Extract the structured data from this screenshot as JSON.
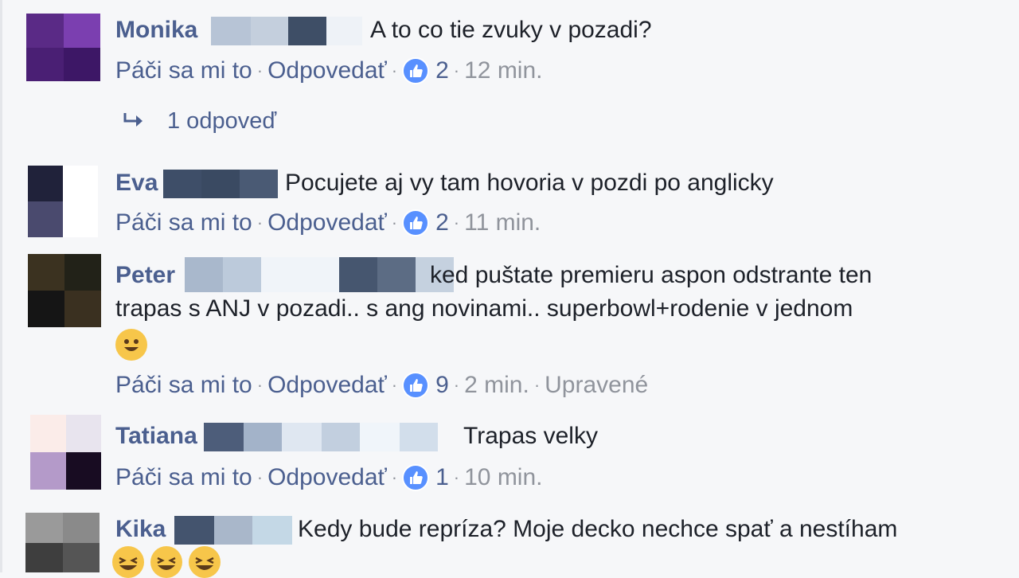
{
  "actions": {
    "like": "Páči sa mi to",
    "reply": "Odpovedať",
    "sep": "·"
  },
  "comments": [
    {
      "name": "Monika",
      "text": "A to co tie zvuky v pozadi?",
      "likes": "2",
      "time": "12 min."
    },
    {
      "name": "Eva",
      "text": "Pocujete aj vy tam hovoria v pozdi po anglicky",
      "likes": "2",
      "time": "11 min."
    },
    {
      "name": "Peter",
      "text_line1": "ked puštate premieru aspon odstrante ten",
      "text_line2": "trapas s ANJ v pozadi.. s ang novinami.. superbowl+rodenie v jednom",
      "likes": "9",
      "time": "2 min.",
      "edited": "Upravené",
      "emoji": "smiling-face"
    },
    {
      "name": "Tatiana",
      "text": "Trapas velky",
      "likes": "1",
      "time": "10 min."
    },
    {
      "name": "Kika",
      "text": "Kedy bude repríza? Moje decko nechce spať a nestíham",
      "emoji": "laughing-face"
    }
  ],
  "replies": {
    "label": "1 odpoveď"
  },
  "colors": {
    "name": "#4b5f8f",
    "text": "#1d2129",
    "meta": "#90949c",
    "like_badge": "#5890ff"
  }
}
